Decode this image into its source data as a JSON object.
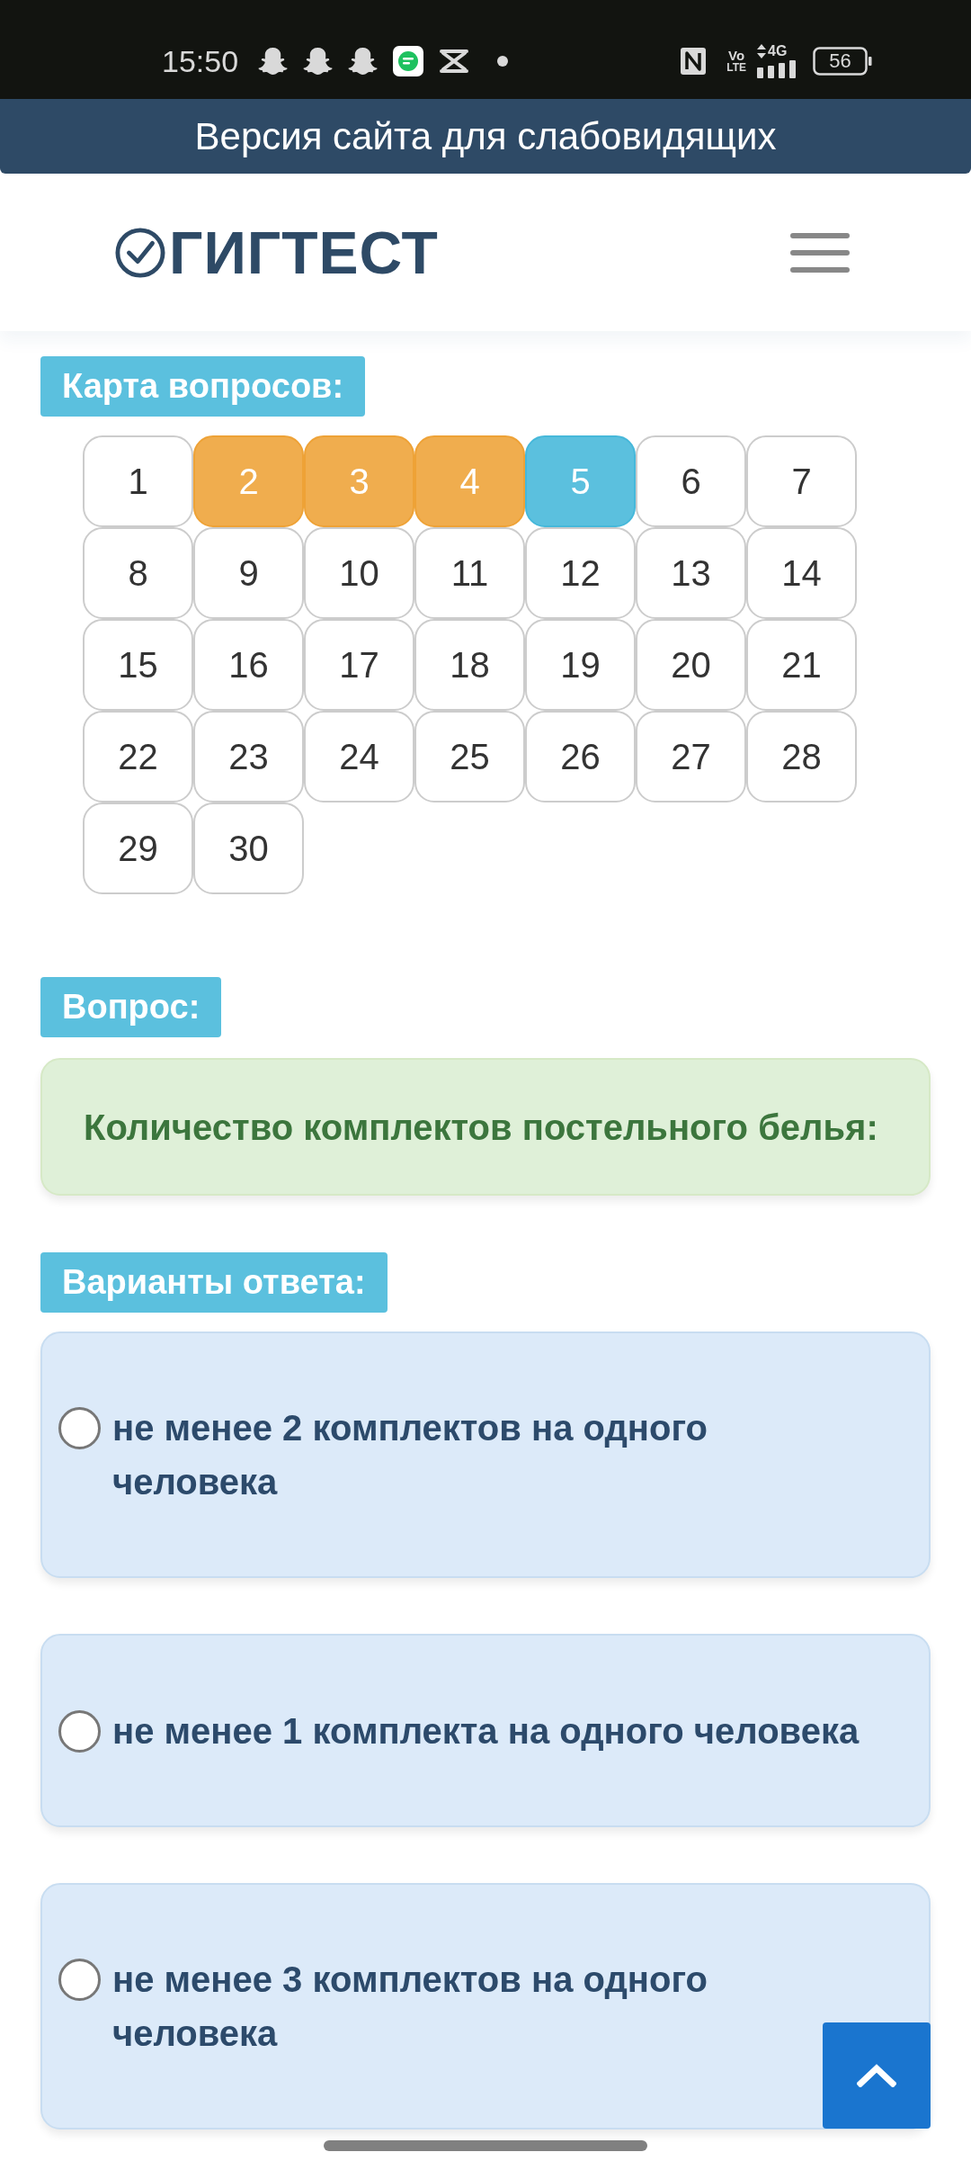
{
  "status_bar": {
    "time": "15:50",
    "volte_top": "Vo",
    "volte_bottom": "LTE",
    "network_type": "4G",
    "battery": "56"
  },
  "banner": {
    "text": "Версия сайта для слабовидящих"
  },
  "header": {
    "logo_text": "ГИГТЕСТ"
  },
  "question_map": {
    "label": "Карта вопросов:",
    "items": [
      {
        "label": "1",
        "answered": false,
        "selected": false
      },
      {
        "label": "2",
        "answered": true,
        "selected": false
      },
      {
        "label": "3",
        "answered": true,
        "selected": false
      },
      {
        "label": "4",
        "answered": true,
        "selected": false
      },
      {
        "label": "5",
        "answered": false,
        "selected": true
      },
      {
        "label": "6",
        "answered": false,
        "selected": false
      },
      {
        "label": "7",
        "answered": false,
        "selected": false
      },
      {
        "label": "8",
        "answered": false,
        "selected": false
      },
      {
        "label": "9",
        "answered": false,
        "selected": false
      },
      {
        "label": "10",
        "answered": false,
        "selected": false
      },
      {
        "label": "11",
        "answered": false,
        "selected": false
      },
      {
        "label": "12",
        "answered": false,
        "selected": false
      },
      {
        "label": "13",
        "answered": false,
        "selected": false
      },
      {
        "label": "14",
        "answered": false,
        "selected": false
      },
      {
        "label": "15",
        "answered": false,
        "selected": false
      },
      {
        "label": "16",
        "answered": false,
        "selected": false
      },
      {
        "label": "17",
        "answered": false,
        "selected": false
      },
      {
        "label": "18",
        "answered": false,
        "selected": false
      },
      {
        "label": "19",
        "answered": false,
        "selected": false
      },
      {
        "label": "20",
        "answered": false,
        "selected": false
      },
      {
        "label": "21",
        "answered": false,
        "selected": false
      },
      {
        "label": "22",
        "answered": false,
        "selected": false
      },
      {
        "label": "23",
        "answered": false,
        "selected": false
      },
      {
        "label": "24",
        "answered": false,
        "selected": false
      },
      {
        "label": "25",
        "answered": false,
        "selected": false
      },
      {
        "label": "26",
        "answered": false,
        "selected": false
      },
      {
        "label": "27",
        "answered": false,
        "selected": false
      },
      {
        "label": "28",
        "answered": false,
        "selected": false
      },
      {
        "label": "29",
        "answered": false,
        "selected": false
      },
      {
        "label": "30",
        "answered": false,
        "selected": false
      }
    ]
  },
  "question": {
    "label": "Вопрос:",
    "text": "Количество комплектов постельного белья:"
  },
  "answers": {
    "label": "Варианты ответа:",
    "options": [
      {
        "text": "не менее 2 комплектов на одного человека",
        "selected": false
      },
      {
        "text": "не менее 1 комплекта на одного человека",
        "selected": false
      },
      {
        "text": "не менее 3 комплектов на одного человека",
        "selected": false
      }
    ]
  }
}
